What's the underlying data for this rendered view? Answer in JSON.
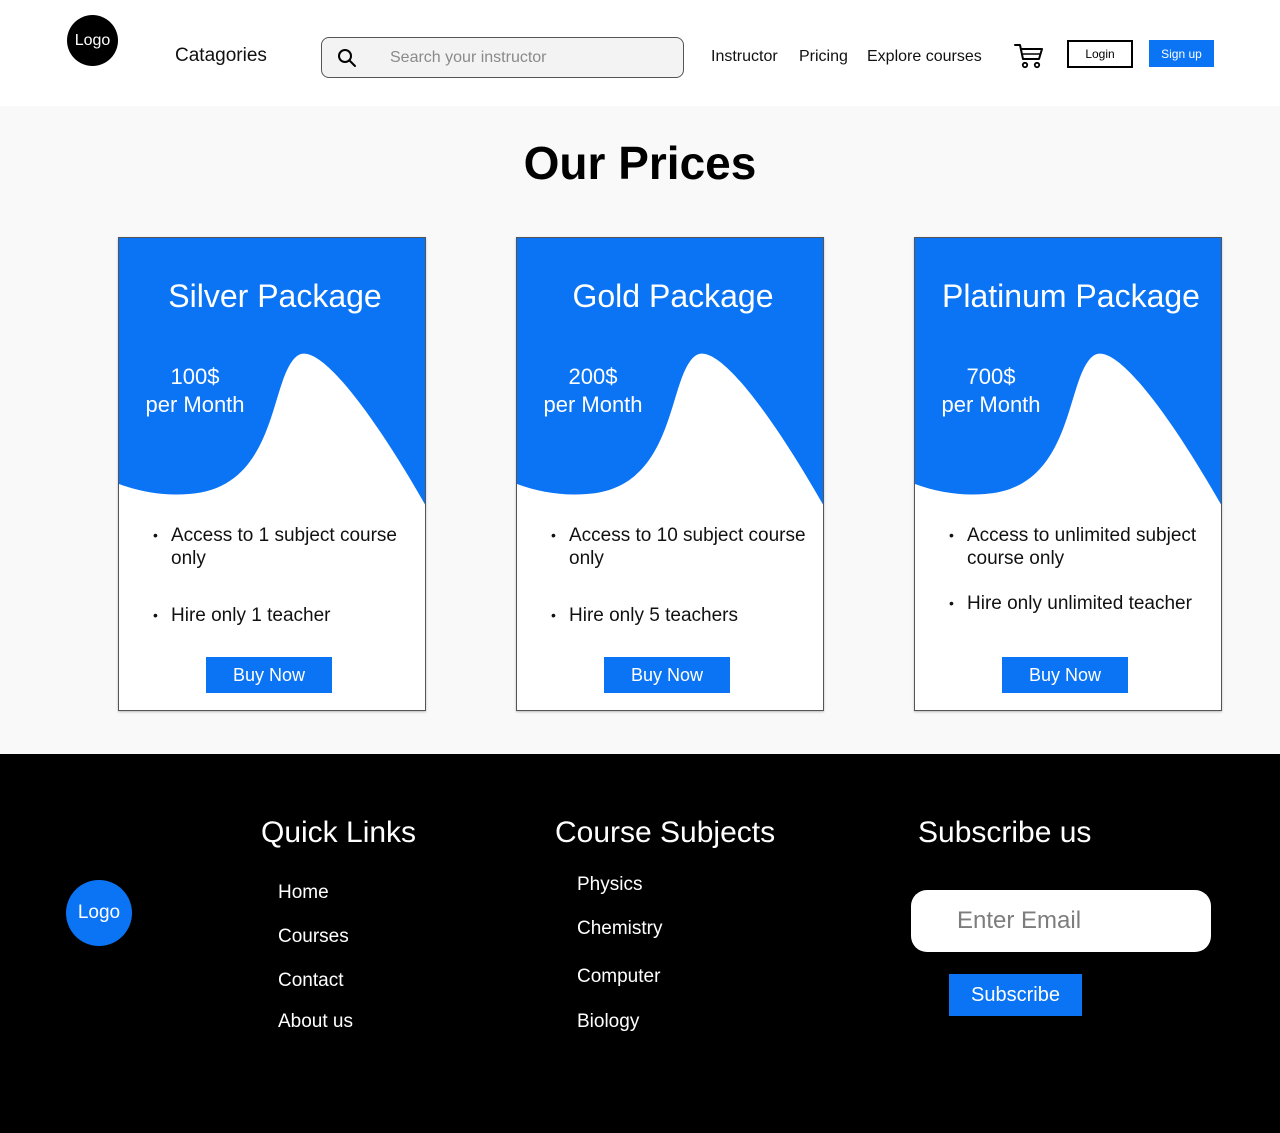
{
  "header": {
    "logo": "Logo",
    "categories": "Catagories",
    "search_placeholder": "Search your instructor",
    "nav": {
      "instructor": "Instructor",
      "pricing": "Pricing",
      "explore": "Explore courses"
    },
    "login": "Login",
    "signup": "Sign up"
  },
  "pricing": {
    "title": "Our Prices",
    "cards": [
      {
        "name": "Silver Package",
        "price": "100$",
        "period": "per Month",
        "features": [
          "Access to 1 subject course only",
          "Hire only 1 teacher"
        ],
        "button": "Buy Now"
      },
      {
        "name": "Gold Package",
        "price": "200$",
        "period": "per Month",
        "features": [
          "Access to 10 subject course only",
          "Hire only 5 teachers"
        ],
        "button": "Buy Now"
      },
      {
        "name": "Platinum Package",
        "price": "700$",
        "period": "per Month",
        "features": [
          "Access to unlimited subject course only",
          "Hire only unlimited teacher"
        ],
        "button": "Buy Now"
      }
    ]
  },
  "footer": {
    "logo": "Logo",
    "quick_links": {
      "heading": "Quick Links",
      "items": [
        "Home",
        "Courses",
        "Contact",
        "About us"
      ]
    },
    "course_subjects": {
      "heading": "Course Subjects",
      "items": [
        "Physics",
        "Chemistry",
        "Computer",
        "Biology"
      ]
    },
    "subscribe": {
      "heading": "Subscribe us",
      "email_placeholder": "Enter Email",
      "button": "Subscribe"
    }
  },
  "colors": {
    "accent": "#0a74f5",
    "footer_bg": "#000000",
    "section_bg": "#f9f9f9"
  },
  "icons": [
    "search-icon",
    "cart-icon"
  ]
}
